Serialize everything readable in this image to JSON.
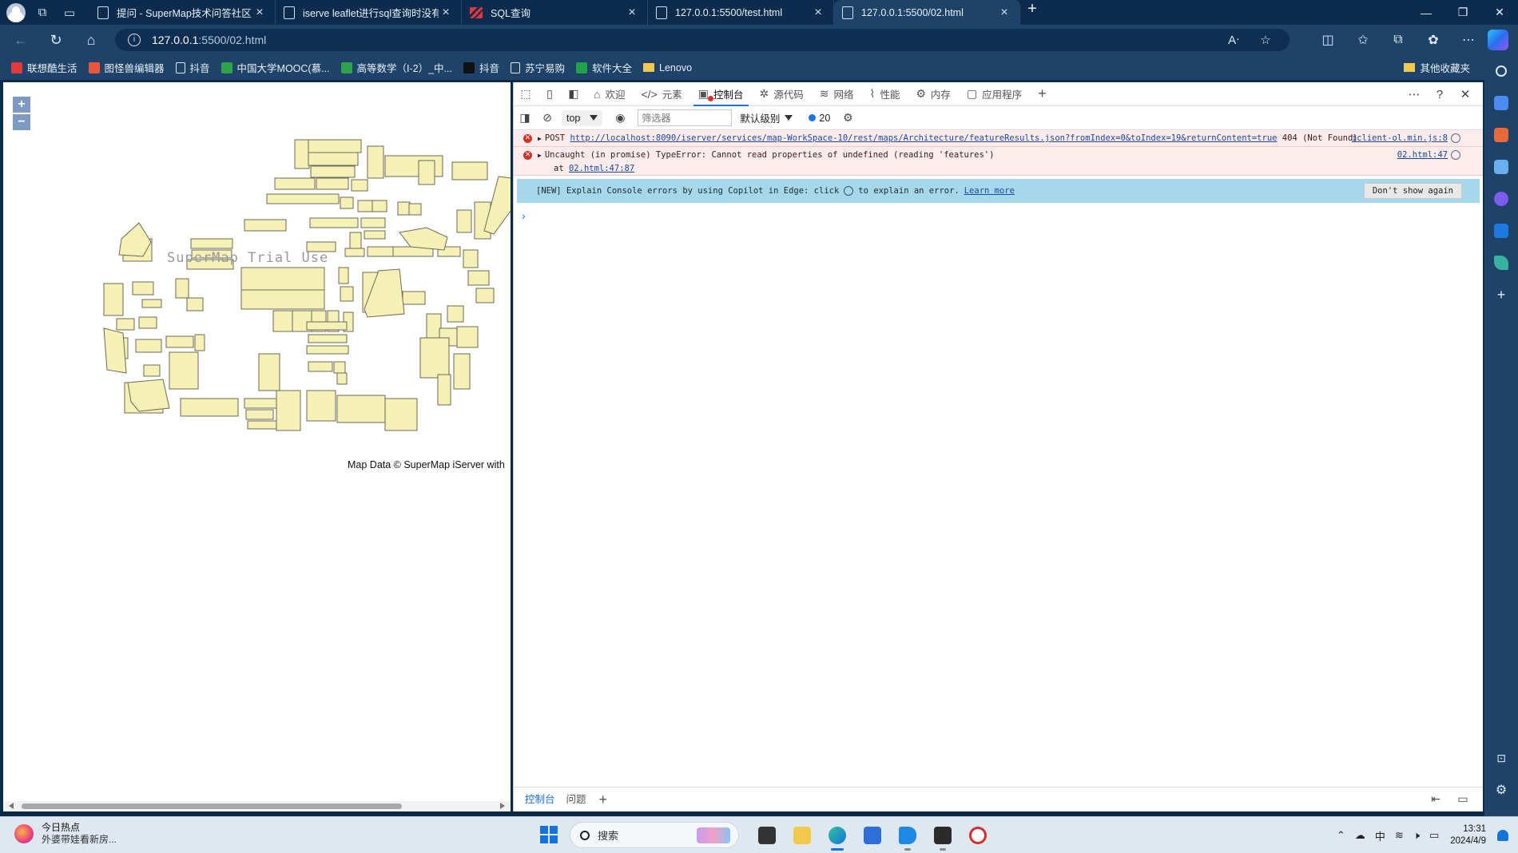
{
  "browser": {
    "tabs": [
      {
        "label": "提问 - SuperMap技术问答社区",
        "active": false,
        "icon": "page-icon"
      },
      {
        "label": "iserve leaflet进行sql查询时没有筛",
        "active": false,
        "icon": "page-icon"
      },
      {
        "label": "SQL查询",
        "active": false,
        "icon": "supermap-logo-icon"
      },
      {
        "label": "127.0.0.1:5500/test.html",
        "active": false,
        "icon": "page-icon"
      },
      {
        "label": "127.0.0.1:5500/02.html",
        "active": true,
        "icon": "page-icon"
      }
    ],
    "close_glyph": "×",
    "new_tab_glyph": "+",
    "window_controls": {
      "minimize": "—",
      "restore": "❐",
      "close": "✕"
    },
    "address": {
      "host": "127.0.0.1",
      "path": ":5500/02.html"
    },
    "bookmarks": [
      {
        "label": "联想酷生活",
        "color": "#e23a3a"
      },
      {
        "label": "图怪兽编辑器",
        "color": "#e8573a"
      },
      {
        "label": "抖音",
        "color": "page"
      },
      {
        "label": "中国大学MOOC(慕...",
        "color": "#2fa34a"
      },
      {
        "label": "高等数学（I-2）_中...",
        "color": "#2fa34a"
      },
      {
        "label": "抖音",
        "color": "#111111"
      },
      {
        "label": "苏宁易购",
        "color": "page"
      },
      {
        "label": "软件大全",
        "color": "#22a34a"
      },
      {
        "label": "Lenovo",
        "color": "folder"
      }
    ],
    "other_bookmarks": "其他收藏夹"
  },
  "map": {
    "zoom_in": "+",
    "zoom_out": "−",
    "watermark": "SuperMap Trial Use",
    "attribution": "Map Data © SuperMap iServer with"
  },
  "devtools": {
    "tabs": [
      {
        "label": "欢迎",
        "glyph": "⌂"
      },
      {
        "label": "元素",
        "glyph": "</>"
      },
      {
        "label": "控制台",
        "glyph": "▣",
        "active": true
      },
      {
        "label": "源代码",
        "glyph": "✲"
      },
      {
        "label": "网络",
        "glyph": "≋"
      },
      {
        "label": "性能",
        "glyph": "⌇"
      },
      {
        "label": "内存",
        "glyph": "⚙"
      },
      {
        "label": "应用程序",
        "glyph": "▢"
      }
    ],
    "add_tab": "+",
    "context": "top",
    "filter_placeholder": "筛选器",
    "level": "默认级别",
    "issue_count": "20",
    "messages": [
      {
        "prefix": "POST",
        "url": "http://localhost:8090/iserver/services/map-WorkSpace-10/rest/maps/Architecture/featureResults.json?fromIndex=0&toIndex=19&returnContent=true",
        "suffix": "404 (Not Found)",
        "source": "iclient-ol.min.js:8"
      },
      {
        "text": "Uncaught (in promise) TypeError: Cannot read properties of undefined (reading 'features')",
        "at_prefix": "at",
        "at_link": "02.html:47:87",
        "source": "02.html:47"
      }
    ],
    "banner": {
      "text_before": "[NEW] Explain Console errors by using Copilot in Edge: click",
      "text_after": "to explain an error.",
      "link": "Learn more",
      "button": "Don't show again"
    },
    "prompt": "›",
    "drawer_tabs": [
      "控制台",
      "问题"
    ],
    "drawer_add": "+"
  },
  "taskbar": {
    "news_title": "今日热点",
    "news_sub": "外婆带娃看新房...",
    "search": "搜索",
    "ime": "中",
    "time": "13:31",
    "date": "2024/4/9"
  }
}
